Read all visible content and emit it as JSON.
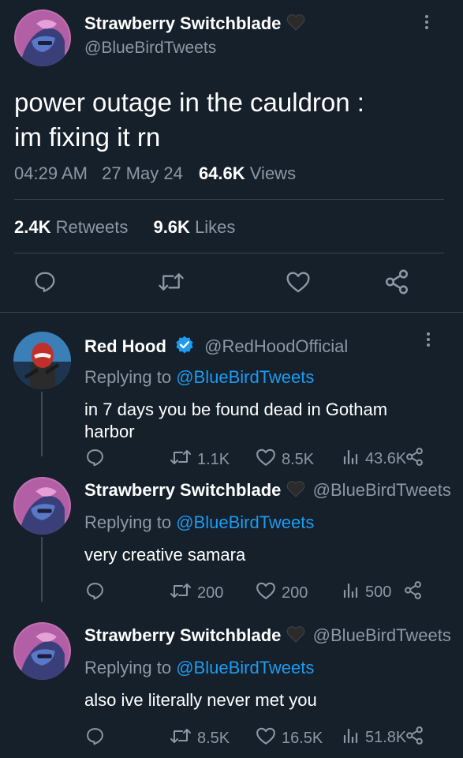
{
  "main_tweet": {
    "display_name": "Strawberry Switchblade",
    "handle": "@BlueBirdTweets",
    "text_line1": "power outage in the cauldron :",
    "text_line2": "im fixing it rn",
    "time": "04:29 AM",
    "date": "27 May 24",
    "views_count": "64.6K",
    "views_label": "Views",
    "retweets_count": "2.4K",
    "retweets_label": "Retweets",
    "likes_count": "9.6K",
    "likes_label": "Likes"
  },
  "replies": [
    {
      "display_name": "Red Hood",
      "handle": "@RedHoodOfficial",
      "replying_prefix": "Replying to",
      "replying_handle": "@BlueBirdTweets",
      "text_line1": "in 7 days you be found dead in Gotham",
      "text_line2": "harbor",
      "retweets": "1.1K",
      "likes": "8.5K",
      "views": "43.6K"
    },
    {
      "display_name": "Strawberry Switchblade",
      "handle": "@BlueBirdTweets",
      "replying_prefix": "Replying to",
      "replying_handle": "@BlueBirdTweets",
      "text_line1": "very creative samara",
      "retweets": "200",
      "likes": "200",
      "views": "500"
    },
    {
      "display_name": "Strawberry Switchblade",
      "handle": "@BlueBirdTweets",
      "replying_prefix": "Replying to",
      "replying_handle": "@BlueBirdTweets",
      "text_line1": "also ive literally never met you",
      "retweets": "8.5K",
      "likes": "16.5K",
      "views": "51.8K"
    }
  ],
  "colors": {
    "background": "#15202b",
    "muted": "#8b98a5",
    "link": "#1d9bf0",
    "verified": "#1d9bf0"
  },
  "icons": [
    "black-heart-emoji",
    "more-vertical-icon",
    "reply-icon",
    "retweet-icon",
    "like-icon",
    "share-icon",
    "views-icon",
    "verified-badge-icon"
  ]
}
